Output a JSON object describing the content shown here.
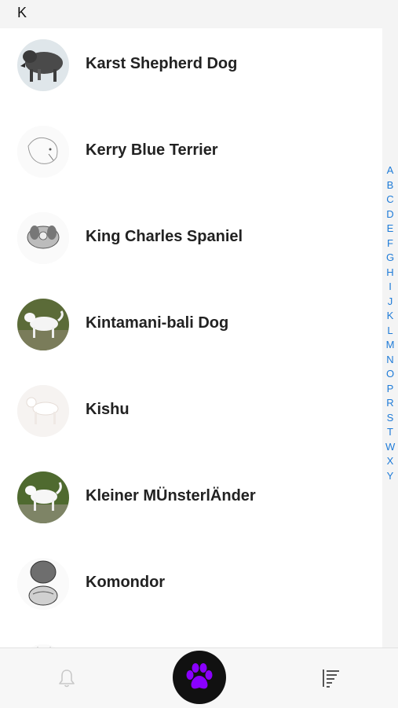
{
  "section": {
    "letter": "K"
  },
  "breeds": [
    {
      "name": "Karst Shepherd Dog",
      "avatar_icon": "dog-photo-icon"
    },
    {
      "name": "Kerry Blue Terrier",
      "avatar_icon": "dog-sketch-icon"
    },
    {
      "name": "King Charles Spaniel",
      "avatar_icon": "dog-sketch-icon"
    },
    {
      "name": "Kintamani-bali Dog",
      "avatar_icon": "dog-photo-icon"
    },
    {
      "name": "Kishu",
      "avatar_icon": "dog-photo-icon"
    },
    {
      "name": "Kleiner MÜnsterlÄnder",
      "avatar_icon": "dog-photo-icon"
    },
    {
      "name": "Komondor",
      "avatar_icon": "dog-sketch-icon"
    }
  ],
  "index_letters": [
    "A",
    "B",
    "C",
    "D",
    "E",
    "F",
    "G",
    "H",
    "I",
    "J",
    "K",
    "L",
    "M",
    "N",
    "O",
    "P",
    "R",
    "S",
    "T",
    "W",
    "X",
    "Y"
  ],
  "nav": {
    "left_icon": "bell-icon",
    "center_icon": "paw-icon",
    "right_icon": "sort-icon"
  },
  "colors": {
    "index_letter": "#1e7bd8",
    "paw_accent": "#8a00ff",
    "paw_button_bg": "#111111"
  }
}
